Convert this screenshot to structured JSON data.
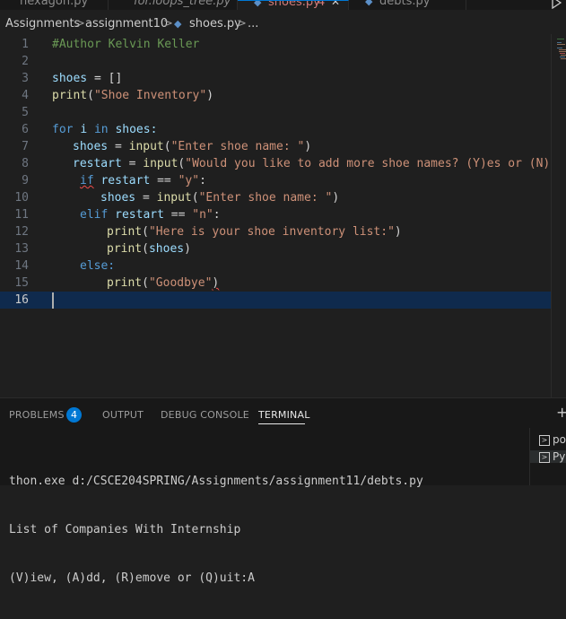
{
  "tabs": [
    {
      "label": "hexagon.py",
      "active": false
    },
    {
      "label": "for.loops_tree.py",
      "active": false
    },
    {
      "label": "shoes.py",
      "badge": "4",
      "active": true,
      "close": "✕"
    },
    {
      "label": "debts.py",
      "active": false
    }
  ],
  "breadcrumb": {
    "folder1": "Assignments",
    "sep": ">",
    "folder2": "assignment10",
    "file": "shoes.py",
    "more": "..."
  },
  "editor": {
    "lines": [
      {
        "n": "1"
      },
      {
        "n": "2"
      },
      {
        "n": "3"
      },
      {
        "n": "4"
      },
      {
        "n": "5"
      },
      {
        "n": "6"
      },
      {
        "n": "7"
      },
      {
        "n": "8"
      },
      {
        "n": "9"
      },
      {
        "n": "10"
      },
      {
        "n": "11"
      },
      {
        "n": "12"
      },
      {
        "n": "13"
      },
      {
        "n": "14"
      },
      {
        "n": "15"
      },
      {
        "n": "16"
      }
    ],
    "code": {
      "comment": "#Author Kelvin Keller",
      "shoes": "shoes",
      "eq": " = ",
      "brackets": "[]",
      "print": "print",
      "lp": "(",
      "rp": ")",
      "shoe_inventory": "\"Shoe Inventory\"",
      "for": "for",
      "i": "i",
      "in": "in",
      "shoes_colon": "shoes:",
      "input": "input",
      "enter_shoe": "\"Enter shoe name: \"",
      "restart": "restart",
      "would_you": "\"Would you like to add more shoe names? (Y)es or (N)o",
      "if": "if",
      "eqeq": " == ",
      "y_str": "\"y\"",
      "colon": ":",
      "elif": "elif",
      "n_str": "\"n\"",
      "here_is": "\"Here is your shoe inventory list:\"",
      "else": "else:",
      "goodbye": "\"Goodbye\""
    }
  },
  "panel": {
    "tabs": {
      "problems": "PROBLEMS",
      "problems_count": "4",
      "output": "OUTPUT",
      "debug": "DEBUG CONSOLE",
      "terminal": "TERMINAL"
    },
    "plus": "+",
    "terminal_lines": [
      "thon.exe d:/CSCE204SPRING/Assignments/assignment11/debts.py",
      "List of Companies With Internship",
      "(V)iew, (A)dd, (R)emove or (Q)uit:A"
    ],
    "terminal_list": [
      "po",
      "Py"
    ]
  },
  "colors": {
    "accent": "#0078d4",
    "keyword": "#569cd6",
    "string": "#ce9178",
    "function": "#dcdcaa",
    "variable": "#9cdcfe",
    "comment": "#6a9955"
  }
}
